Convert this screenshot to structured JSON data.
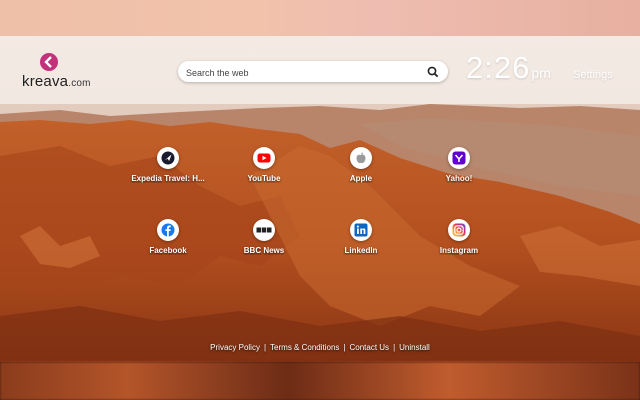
{
  "brand": {
    "name": "kreava",
    "suffix": ".com",
    "accent": "#c2317a"
  },
  "search": {
    "placeholder": "Search the web",
    "button_icon": "search-icon"
  },
  "clock": {
    "time": "2:26",
    "ampm": "pm"
  },
  "settings_label": "Settings",
  "tiles": [
    {
      "label": "Expedia Travel: H...",
      "icon": "expedia-icon",
      "color": "#1a1a2e"
    },
    {
      "label": "YouTube",
      "icon": "youtube-icon",
      "color": "#ff0000"
    },
    {
      "label": "Apple",
      "icon": "apple-icon",
      "color": "#999999"
    },
    {
      "label": "Yahoo!",
      "icon": "yahoo-icon",
      "color": "#6001d2"
    },
    {
      "label": "Facebook",
      "icon": "facebook-icon",
      "color": "#1877f2"
    },
    {
      "label": "BBC News",
      "icon": "bbc-icon",
      "color": "#222222"
    },
    {
      "label": "LinkedIn",
      "icon": "linkedin-icon",
      "color": "#0a66c2"
    },
    {
      "label": "Instagram",
      "icon": "instagram-icon",
      "color": "#d6249f"
    }
  ],
  "footer": {
    "links": [
      "Privacy Policy",
      "Terms & Conditions",
      "Contact Us",
      "Uninstall"
    ],
    "separator": "|"
  }
}
